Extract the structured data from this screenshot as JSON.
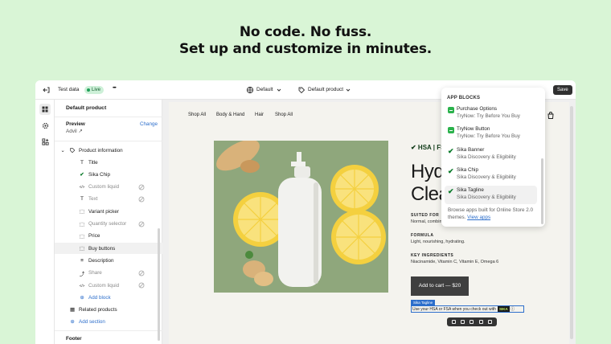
{
  "headline": {
    "line1": "No code. No fuss.",
    "line2": "Set up and customize in minutes."
  },
  "topbar": {
    "test_data": "Test data",
    "live_badge": "Live",
    "more": "•••",
    "theme_select": "Default",
    "template_select": "Default product",
    "save_label": "Save"
  },
  "sidebar": {
    "title": "Default product",
    "preview_label": "Preview",
    "change_label": "Change",
    "preview_product": "Advil",
    "section_label": "Product information",
    "blocks": [
      {
        "label": "Title",
        "icon": "title-icon",
        "muted": false
      },
      {
        "label": "Sika Chip",
        "icon": "checkmark-icon",
        "muted": false
      },
      {
        "label": "Custom liquid",
        "icon": "code-icon",
        "muted": true
      },
      {
        "label": "Text",
        "icon": "text-icon",
        "muted": true
      },
      {
        "label": "Variant picker",
        "icon": "variant-icon",
        "muted": false
      },
      {
        "label": "Quantity selector",
        "icon": "quantity-icon",
        "muted": true
      },
      {
        "label": "Price",
        "icon": "price-icon",
        "muted": false
      },
      {
        "label": "Buy buttons",
        "icon": "buy-icon",
        "muted": false
      },
      {
        "label": "Description",
        "icon": "description-icon",
        "muted": false
      },
      {
        "label": "Share",
        "icon": "share-icon",
        "muted": true
      },
      {
        "label": "Custom liquid",
        "icon": "code-icon",
        "muted": true
      }
    ],
    "add_block": "Add block",
    "related_products": "Related products",
    "add_section": "Add section",
    "footer": "Footer"
  },
  "store": {
    "nav": [
      "Shop All",
      "Body & Hand",
      "Hair",
      "Shop All"
    ],
    "brand": "✔ HSA | FSA",
    "title_line1": "Hydra",
    "title_line2": "Clea",
    "suited_for_label": "SUITED FOR",
    "suited_for_value": "Normal, combinatio",
    "formula_label": "FORMULA",
    "formula_value": "Light, nourishing, hydrating.",
    "ingredients_label": "KEY INGREDIENTS",
    "ingredients_value": "Niacinamide, Vitamin C, Vitamin E, Omega 6",
    "cart_button": "Add to cart — $20",
    "sika_tag": "Sika Tagline",
    "sika_line": "Use your HSA or FSA when you check out with",
    "sika_logo": "SIKA"
  },
  "popup": {
    "heading": "APP BLOCKS",
    "items": [
      {
        "name": "Purchase Options",
        "app": "TryNow: Try Before You Buy",
        "icon": "trynow-icon",
        "selected": false
      },
      {
        "name": "TryNow Button",
        "app": "TryNow: Try Before You Buy",
        "icon": "trynow-icon",
        "selected": false
      },
      {
        "name": "Sika Banner",
        "app": "Sika Discovery & Eligibility",
        "icon": "sika-check-icon",
        "selected": false
      },
      {
        "name": "Sika Chip",
        "app": "Sika Discovery & Eligibility",
        "icon": "sika-check-icon",
        "selected": false
      },
      {
        "name": "Sika Tagline",
        "app": "Sika Discovery & Eligibility",
        "icon": "sika-check-icon",
        "selected": true
      }
    ],
    "browse_text": "Browse apps built for Online Store 2.0 themes.",
    "view_apps": "View apps"
  },
  "colors": {
    "background": "#d9f5d6",
    "accent": "#2c6ecb",
    "live": "#cdf0d8",
    "photo": "#8fa77c"
  }
}
